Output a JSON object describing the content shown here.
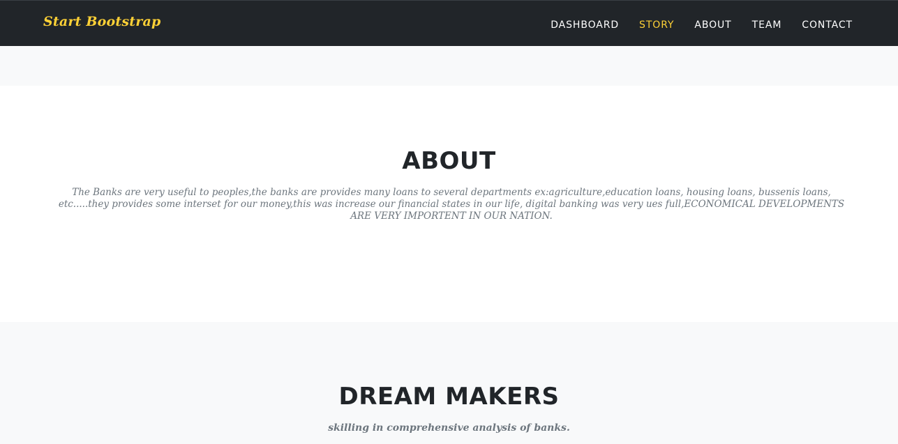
{
  "navbar": {
    "brand": "Start Bootstrap",
    "links": [
      {
        "label": "DASHBOARD",
        "active": false
      },
      {
        "label": "STORY",
        "active": true
      },
      {
        "label": "ABOUT",
        "active": false
      },
      {
        "label": "TEAM",
        "active": false
      },
      {
        "label": "CONTACT",
        "active": false
      }
    ]
  },
  "about": {
    "heading": "ABOUT",
    "text": "The Banks are very useful to peoples,the banks are provides many loans to several departments ex:agriculture,education loans, housing loans, bussenis loans, etc.....they provides some interset for our money,this was increase our financial states in our life, digital banking was very ues full,ECONOMICAL DEVELOPMENTS ARE VERY IMPORTENT IN OUR NATION."
  },
  "team": {
    "heading": "DREAM MAKERS",
    "subheading": "skilling in comprehensive analysis of banks."
  },
  "colors": {
    "navbar_bg": "#212529",
    "accent": "#fed136",
    "heading": "#212529",
    "muted_text": "#6c757d",
    "light_bg": "#f8f9fa"
  }
}
